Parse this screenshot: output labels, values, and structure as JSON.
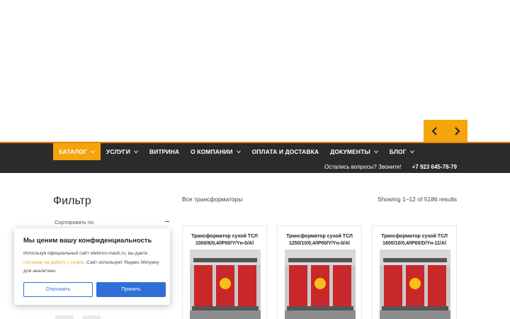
{
  "slider": {
    "prev_icon": "chevron-left-icon",
    "next_icon": "chevron-right-icon"
  },
  "nav": {
    "items": [
      {
        "label": "КАТАЛОГ",
        "has_dropdown": true,
        "active": true
      },
      {
        "label": "УСЛУГИ",
        "has_dropdown": true,
        "active": false
      },
      {
        "label": "ВИТРИНА",
        "has_dropdown": false,
        "active": false
      },
      {
        "label": "О КОМПАНИИ",
        "has_dropdown": true,
        "active": false
      },
      {
        "label": "ОПЛАТА И ДОСТАВКА",
        "has_dropdown": false,
        "active": false
      },
      {
        "label": "ДОКУМЕНТЫ",
        "has_dropdown": true,
        "active": false
      },
      {
        "label": "БЛОГ",
        "has_dropdown": true,
        "active": false
      }
    ],
    "question": "Остались вопросы? Звоните!",
    "phone": "+7 923 645-78-79"
  },
  "filter": {
    "title": "Фильтр",
    "sort_label": "Сортировать по"
  },
  "listing": {
    "breadcrumb": "Все трансформаторы",
    "results": "Showing 1–12 of 5186 results",
    "products": [
      {
        "title": "Трансформатор сухой ТСЛ 1000/6/0,4/IP00/Y/Yн-0/Al"
      },
      {
        "title": "Трансформатор сухой ТСЛ 1250/10/0,4/IP00/Y/Yн-0/Al"
      },
      {
        "title": "Трансформатор сухой ТСЛ 1600/10/0,4/IP00/D/Yн-11/Al"
      }
    ]
  },
  "cookie": {
    "title": "Мы ценим вашу конфиденциальность",
    "text_before": "Используя официальный сайт elektron-mash.ru, вы даете ",
    "link": "согласие на работу с cookie",
    "text_after": ". Сайт использует Яндекс Метрику для аналитики.",
    "decline": "Отклонить",
    "accept": "Принять"
  },
  "colors": {
    "accent": "#f5a50b",
    "nav_bg": "#2b2b2b",
    "button_blue": "#2f6fd6",
    "product_red": "#c8282a"
  }
}
